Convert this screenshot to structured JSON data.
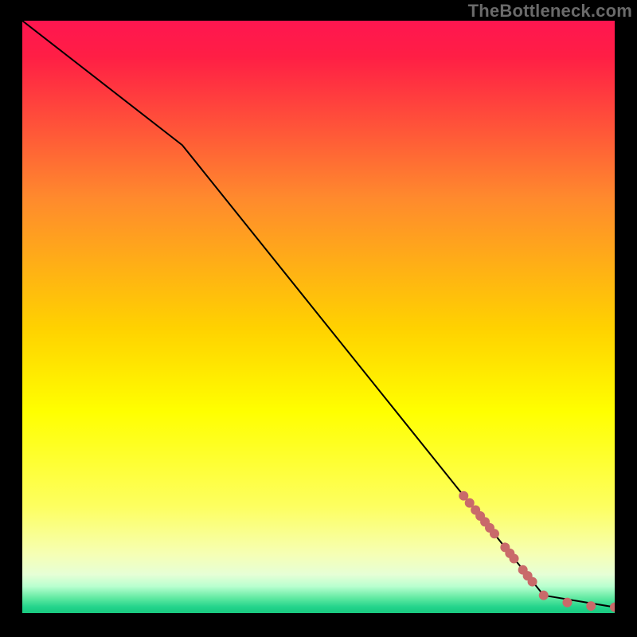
{
  "watermark": "TheBottleneck.com",
  "chart_data": {
    "type": "line",
    "title": "",
    "xlabel": "",
    "ylabel": "",
    "xlim": [
      0,
      100
    ],
    "ylim": [
      0,
      100
    ],
    "grid": false,
    "legend": false,
    "background": {
      "type": "vertical-gradient",
      "stops": [
        {
          "pos": 0.0,
          "color": "#ff1650"
        },
        {
          "pos": 0.06,
          "color": "#ff1e45"
        },
        {
          "pos": 0.3,
          "color": "#ff8a2d"
        },
        {
          "pos": 0.52,
          "color": "#ffd200"
        },
        {
          "pos": 0.66,
          "color": "#ffff00"
        },
        {
          "pos": 0.82,
          "color": "#fdff60"
        },
        {
          "pos": 0.9,
          "color": "#f6ffb4"
        },
        {
          "pos": 0.935,
          "color": "#e6ffd6"
        },
        {
          "pos": 0.955,
          "color": "#b8ffcf"
        },
        {
          "pos": 0.975,
          "color": "#5fe9a1"
        },
        {
          "pos": 0.99,
          "color": "#22d38b"
        },
        {
          "pos": 1.0,
          "color": "#19c97f"
        }
      ]
    },
    "series": [
      {
        "name": "bottleneck-curve",
        "color": "#000000",
        "stroke_width": 2,
        "points_xy": [
          [
            0.0,
            100.0
          ],
          [
            27.0,
            79.0
          ],
          [
            88.0,
            3.0
          ],
          [
            100.0,
            1.0
          ]
        ]
      }
    ],
    "markers": {
      "name": "highlight-dots",
      "color": "#c96a6a",
      "radius": 6,
      "points_xy": [
        [
          74.5,
          19.8
        ],
        [
          75.5,
          18.6
        ],
        [
          76.5,
          17.4
        ],
        [
          77.3,
          16.4
        ],
        [
          78.1,
          15.4
        ],
        [
          78.9,
          14.4
        ],
        [
          79.7,
          13.4
        ],
        [
          81.5,
          11.1
        ],
        [
          82.3,
          10.1
        ],
        [
          83.0,
          9.2
        ],
        [
          84.5,
          7.3
        ],
        [
          85.3,
          6.3
        ],
        [
          86.1,
          5.3
        ],
        [
          88.0,
          3.0
        ],
        [
          92.0,
          1.8
        ],
        [
          96.0,
          1.2
        ],
        [
          100.0,
          1.0
        ]
      ]
    }
  }
}
